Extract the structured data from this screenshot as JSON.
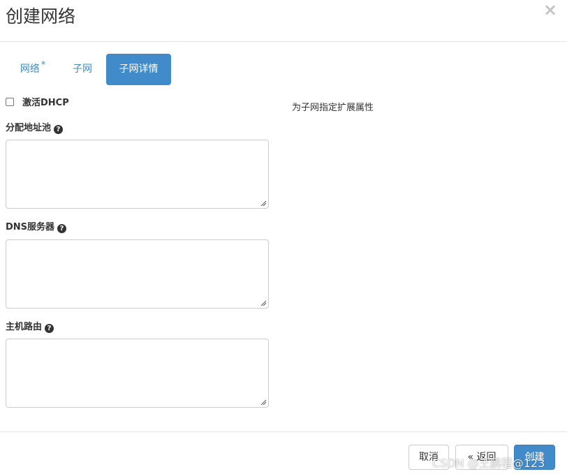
{
  "header": {
    "title": "创建网络",
    "close_label": "×"
  },
  "tabs": [
    {
      "label": "网络",
      "required_mark": "*",
      "active": false
    },
    {
      "label": "子网",
      "active": false
    },
    {
      "label": "子网详情",
      "active": true
    }
  ],
  "form": {
    "enable_dhcp": {
      "label": "激活DHCP",
      "checked": false
    },
    "fields": [
      {
        "label": "分配地址池",
        "value": ""
      },
      {
        "label": "DNS服务器",
        "value": ""
      },
      {
        "label": "主机路由",
        "value": ""
      }
    ],
    "help_glyph": "?"
  },
  "description": "为子网指定扩展属性",
  "footer": {
    "cancel_label": "取消",
    "back_label": "« 返回",
    "create_label": "创建"
  },
  "watermark": "CSDN @王鹏程@123",
  "colors": {
    "primary": "#428bca",
    "border": "#cccccc",
    "text": "#333333"
  }
}
